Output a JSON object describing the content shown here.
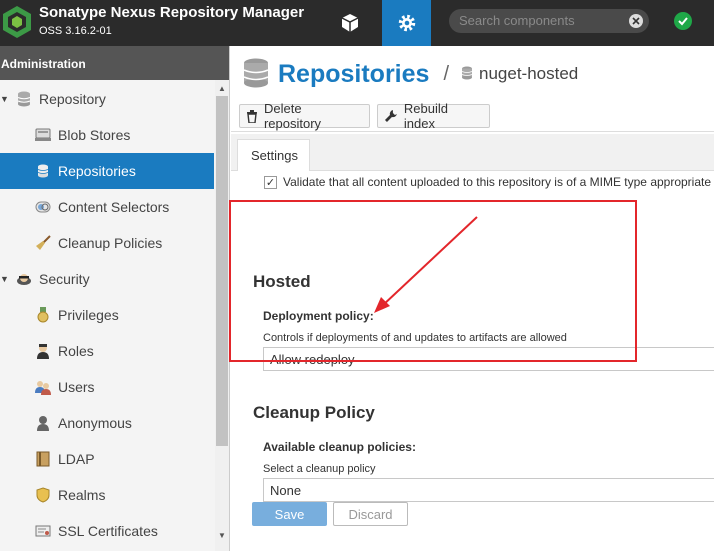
{
  "header": {
    "app_title": "Sonatype Nexus Repository Manager",
    "version": "OSS 3.16.2-01",
    "search_placeholder": "Search components",
    "colors": {
      "bar": "#2b2b2b",
      "accent": "#1a7bc0",
      "status_ok": "#1fa848"
    }
  },
  "sidebar": {
    "header": "Administration",
    "items": [
      {
        "label": "Repository",
        "icon": "database-icon",
        "group": true
      },
      {
        "label": "Blob Stores",
        "icon": "blob-store-icon"
      },
      {
        "label": "Repositories",
        "icon": "database-icon",
        "selected": true
      },
      {
        "label": "Content Selectors",
        "icon": "content-selector-icon"
      },
      {
        "label": "Cleanup Policies",
        "icon": "broom-icon"
      },
      {
        "label": "Security",
        "icon": "security-icon",
        "group": true
      },
      {
        "label": "Privileges",
        "icon": "medal-icon"
      },
      {
        "label": "Roles",
        "icon": "role-icon"
      },
      {
        "label": "Users",
        "icon": "users-icon"
      },
      {
        "label": "Anonymous",
        "icon": "anonymous-icon"
      },
      {
        "label": "LDAP",
        "icon": "book-icon"
      },
      {
        "label": "Realms",
        "icon": "shield-icon"
      },
      {
        "label": "SSL Certificates",
        "icon": "certificate-icon"
      }
    ]
  },
  "main": {
    "breadcrumb": {
      "title": "Repositories",
      "separator": "/",
      "current": "nuget-hosted"
    },
    "toolbar": {
      "delete_label": "Delete repository",
      "rebuild_label": "Rebuild index"
    },
    "tab": "Settings",
    "content_validation_label": "Validate that all content uploaded to this repository is of a MIME type appropriate for the repository format",
    "hosted": {
      "title": "Hosted",
      "deployment_policy_label": "Deployment policy:",
      "deployment_policy_help": "Controls if deployments of and updates to artifacts are allowed",
      "deployment_policy_value": "Allow redeploy"
    },
    "cleanup": {
      "title": "Cleanup Policy",
      "available_label": "Available cleanup policies:",
      "help": "Select a cleanup policy",
      "value": "None"
    },
    "save_label": "Save",
    "discard_label": "Discard"
  }
}
